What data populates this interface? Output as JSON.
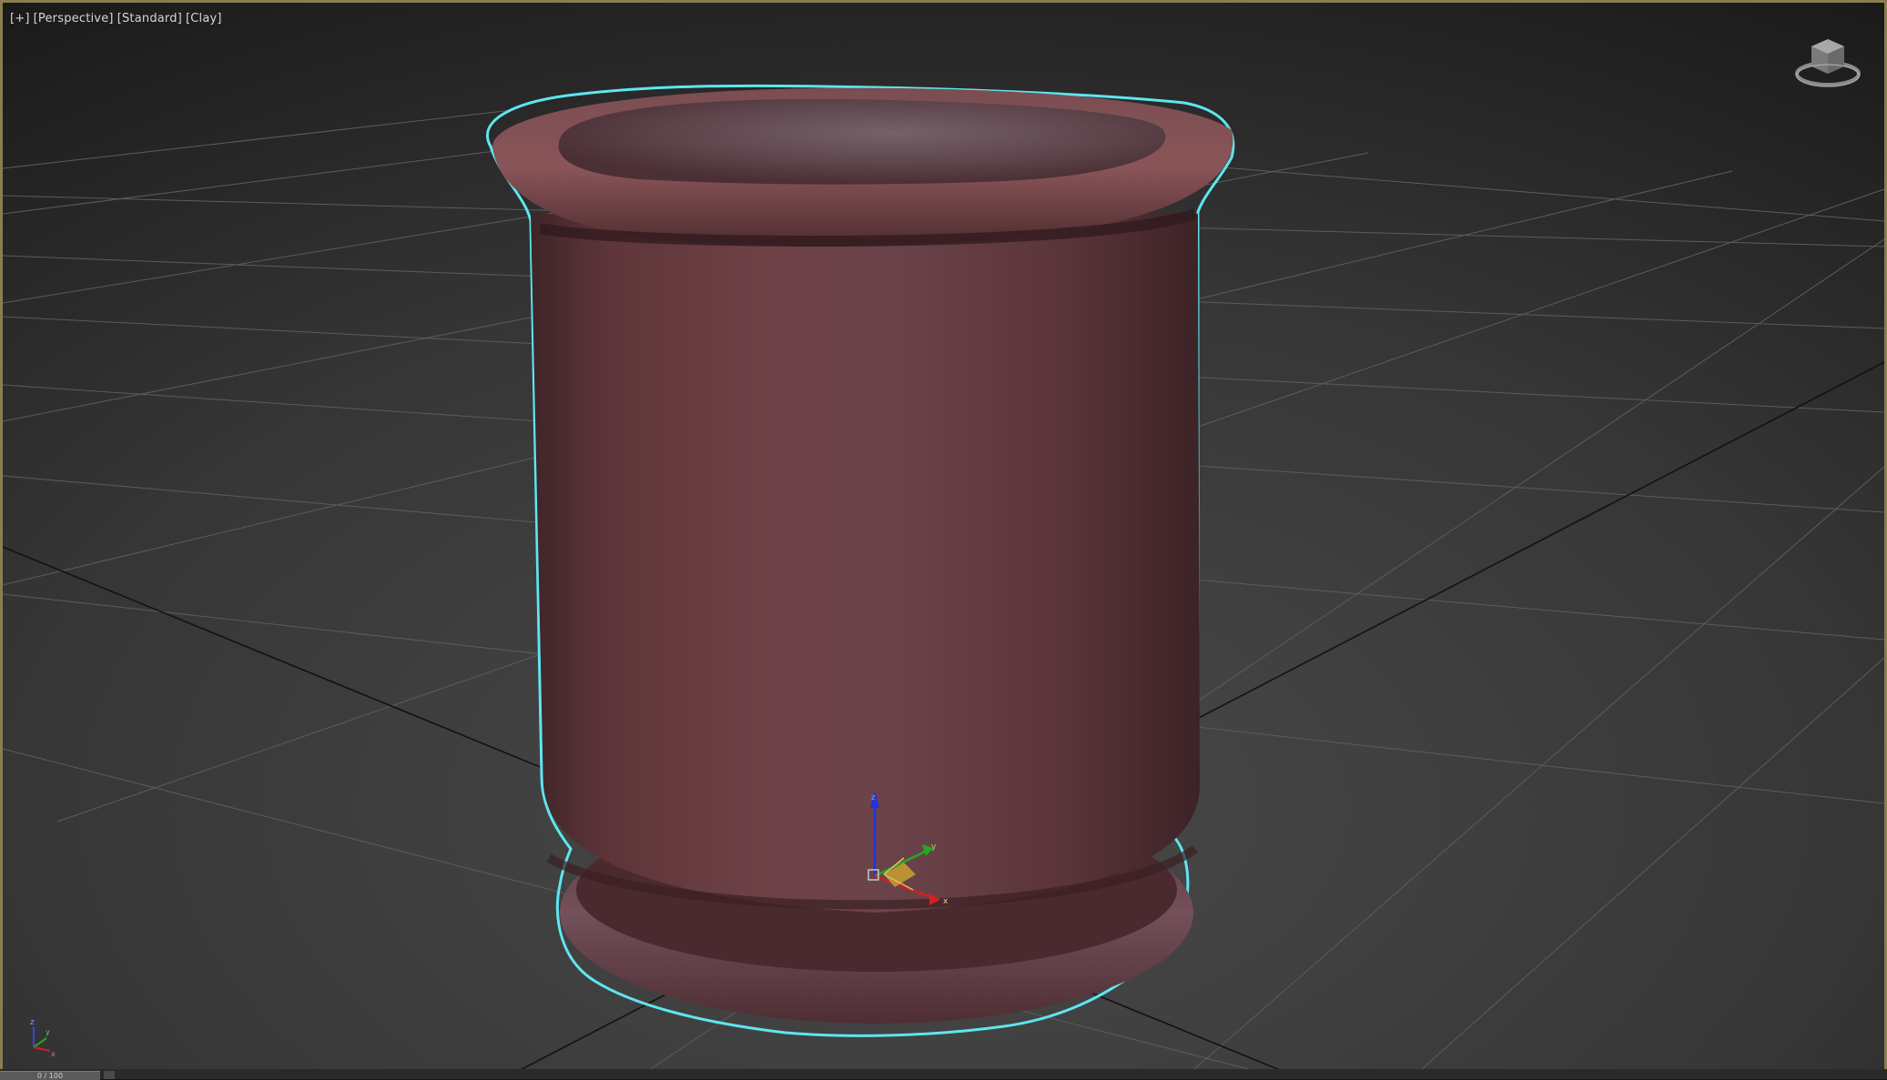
{
  "viewport": {
    "labels": [
      "[+]",
      "[Perspective]",
      "[Standard]",
      "[Clay]"
    ],
    "border_color": "#8b7d4f",
    "selection_outline_color": "#5ee6f0",
    "object_color": "#6b3f45"
  },
  "gizmo": {
    "axis_x": "x",
    "axis_y": "y",
    "axis_z": "z"
  },
  "corner_axis": {
    "axis_x": "x",
    "axis_y": "y",
    "axis_z": "z"
  },
  "timeline": {
    "frame_readout": "0 / 100"
  },
  "icons": [
    "viewcube-icon",
    "transform-gizmo-icon",
    "world-axis-icon"
  ]
}
